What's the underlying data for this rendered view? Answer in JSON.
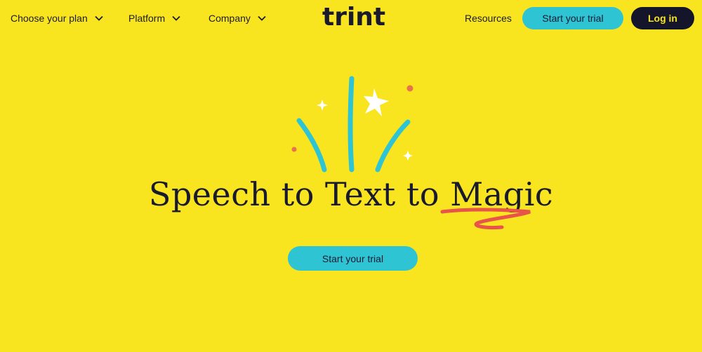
{
  "nav": {
    "plan_label": "Choose your plan",
    "platform_label": "Platform",
    "company_label": "Company",
    "logo_text": "trint",
    "resources_label": "Resources",
    "trial_label": "Start your trial",
    "login_label": "Log in"
  },
  "hero": {
    "headline_part1": "Speech to Text to ",
    "headline_magic": "Magic",
    "cta_label": "Start your trial"
  },
  "colors": {
    "background": "#f9e51f",
    "accent_teal": "#2ec4d4",
    "dark": "#14152a",
    "squiggle_red": "#e8534a"
  }
}
